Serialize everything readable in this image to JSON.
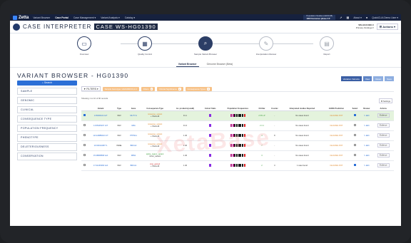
{
  "topbar": {
    "logo": "Zetta",
    "nav": [
      "Variant Browser",
      "Case Portal",
      "Case Management ▾",
      "Variant Analysis ▾",
      "Catalog ▾"
    ],
    "active_nav": 1,
    "project_line1": "Population Studies (GRCh38)",
    "project_line2": "1000 Genomes phase 3 ▾",
    "about": "About ▾",
    "user": "QuickCLIA Demo User ▾"
  },
  "case": {
    "title": "CASE INTERPRETER",
    "id": "CASE WS-HG01390",
    "right_line1": "WS-HG01390-0",
    "right_line2": "Primary Findings ▾",
    "actions": "☰ Actions ▾"
  },
  "steps": [
    {
      "label": "Overview",
      "icon": "▭",
      "state": "done"
    },
    {
      "label": "Quality Control",
      "icon": "▦",
      "state": "done"
    },
    {
      "label": "Sample Variant Browser",
      "icon": "⌕",
      "state": "active"
    },
    {
      "label": "Interpretation Review",
      "icon": "✎",
      "state": "pending"
    },
    {
      "label": "Report",
      "icon": "▤",
      "state": "pending"
    }
  ],
  "subtabs": [
    "Variant Browser",
    "Genome Browser (Beta)"
  ],
  "vb_title": "VARIANT BROWSER - HG01390",
  "sidebar": {
    "search": "⌕ Search",
    "items": [
      "SAMPLE",
      "GENOMIC",
      "CLINICAL",
      "CONSEQUENCE TYPE",
      "POPULATION FREQUENCY",
      "PHENOTYPE",
      "DELETERIOUSNESS",
      "CONSERVATION"
    ]
  },
  "toolbar": [
    "Variation Variants",
    "View",
    "Reset",
    "Save"
  ],
  "filters": {
    "label": "▼ FILTERS ▾",
    "chips": [
      {
        "text": "Sample Genotype: HG01390:0/1,1/1",
        "count": ""
      },
      {
        "text": "Filters",
        "count": "1"
      },
      {
        "text": "Clinical Significance",
        "count": "2"
      },
      {
        "text": "Consequence Types",
        "count": "9"
      }
    ]
  },
  "showing": "Showing 1 to 10 of 90 records",
  "settings": "⚙ Settings",
  "watermark": "XetaBase",
  "table": {
    "headers": [
      "",
      "Variant",
      "Type",
      "",
      "Gene",
      "Consequence Type",
      "Ac. products(i,cadd)",
      "Cohort Stats",
      "Population Frequencies",
      "ClinVar",
      "Cosmic",
      "Interpreted studies Reported",
      "ACMG Prediction",
      "Select",
      "Review",
      "Actions"
    ],
    "rows": [
      {
        "variant": "1:45000104 G/T",
        "type": "SNV",
        "gene": "MUTYH",
        "cons": "missense_variant",
        "cons2": "+ Show All",
        "ccls": "cons-o",
        "cadd": "31.1",
        "coh": "#8a2be2",
        "clin": "2 Pb LP",
        "cosmic": "-",
        "interp": "No cases found",
        "acmg": "NA ACMG POT",
        "sel": true,
        "selected": true
      },
      {
        "variant": "1:155235167 G/T",
        "type": "SNV",
        "gene": "GBA",
        "cons": "missense_variant",
        "cons2": "+ Show All",
        "ccls": "cons-o",
        "cadd": "31.3",
        "coh": "#8a2be2",
        "clin": "2 4 1",
        "cosmic": "-",
        "interp": "No cases found",
        "acmg": "NA ACMG POT",
        "sel": false,
        "selected": false
      },
      {
        "variant": "12:112888210 C/T",
        "type": "SNV",
        "gene": "PTPN11",
        "cons": "missense_variant",
        "cons2": "+ Show All",
        "ccls": "cons-o",
        "cadd": "1.46",
        "coh": "#8a2be2",
        "clin": "4",
        "cosmic": "8",
        "interp": "No cases found",
        "acmg": "NA ACMG POT",
        "sel": false,
        "selected": false
      },
      {
        "variant": "13:32914438 T/-",
        "type": "INDEL",
        "gene": "BRCA2",
        "cons": "missense_variant",
        "cons2": "+ Show All",
        "ccls": "cons-o",
        "cadd": "1.46",
        "coh": "#8a2be2",
        "clin": "7",
        "cosmic": "-",
        "interp": "No cases found",
        "acmg": "NA ACMG POT",
        "sel": false,
        "selected": false
      },
      {
        "variant": "15:48808568 G/A",
        "type": "SNV",
        "gene": "FBN1",
        "cons": "splice_region_variant",
        "cons2": "intron_variant",
        "ccls": "cons-g",
        "cadd": "1.46",
        "coh": "#8a2be2",
        "clin": "3",
        "cosmic": "-",
        "interp": "No cases found",
        "acmg": "NA ACMG POT",
        "sel": false,
        "selected": false
      },
      {
        "variant": "17:41245466 G/A",
        "type": "SNV",
        "gene": "BRCA1",
        "cons": "stop_gained",
        "cons2": "+ Show All",
        "ccls": "cons-r",
        "cadd": "1.46",
        "coh": "#8a2be2",
        "clin": "2",
        "cosmic": "3",
        "interp": "1 case found",
        "acmg": "NA ACMG POT",
        "sel": true,
        "selected": false
      }
    ],
    "review": "✎ Edit",
    "actions": "Evidence"
  }
}
